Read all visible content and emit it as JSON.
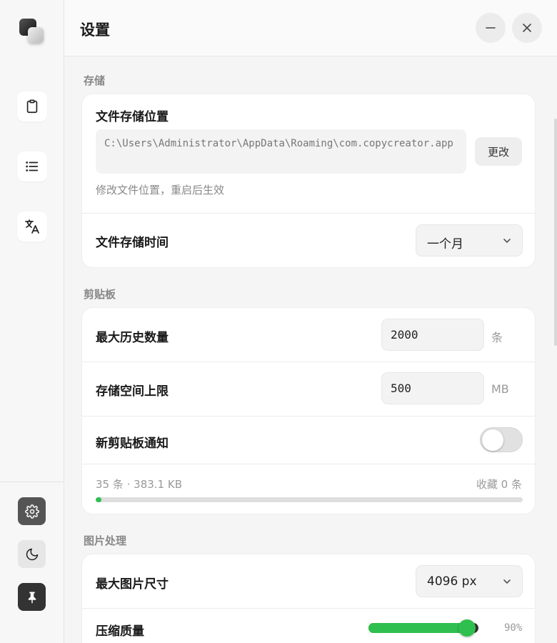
{
  "window": {
    "title": "设置"
  },
  "sidebar": {
    "nav": [
      {
        "icon": "clipboard-icon"
      },
      {
        "icon": "list-icon"
      },
      {
        "icon": "translate-icon"
      }
    ],
    "bottom": [
      {
        "icon": "gear-icon"
      },
      {
        "icon": "moon-icon"
      },
      {
        "icon": "pin-icon"
      }
    ]
  },
  "storage": {
    "section_title": "存储",
    "location_label": "文件存储位置",
    "path": "C:\\Users\\Administrator\\AppData\\Roaming\\com.copycreator.app",
    "change_button": "更改",
    "hint": "修改文件位置，重启后生效",
    "retention_label": "文件存储时间",
    "retention_value": "一个月"
  },
  "clipboard": {
    "section_title": "剪贴板",
    "max_history_label": "最大历史数量",
    "max_history_value": "2000",
    "max_history_unit": "条",
    "space_limit_label": "存储空间上限",
    "space_limit_value": "500",
    "space_limit_unit": "MB",
    "notify_label": "新剪贴板通知",
    "notify_enabled": false,
    "stats_left": "35 条 · 383.1 KB",
    "stats_right": "收藏 0 条",
    "usage_fraction": 0.012
  },
  "image": {
    "section_title": "图片处理",
    "max_size_label": "最大图片尺寸",
    "max_size_value": "4096 px",
    "quality_label": "压缩质量",
    "quality_value": "90%",
    "quality_fraction": 0.9
  },
  "colors": {
    "accent": "#2fbf4f",
    "active_nav": "#555555",
    "pin_button": "#333333"
  }
}
